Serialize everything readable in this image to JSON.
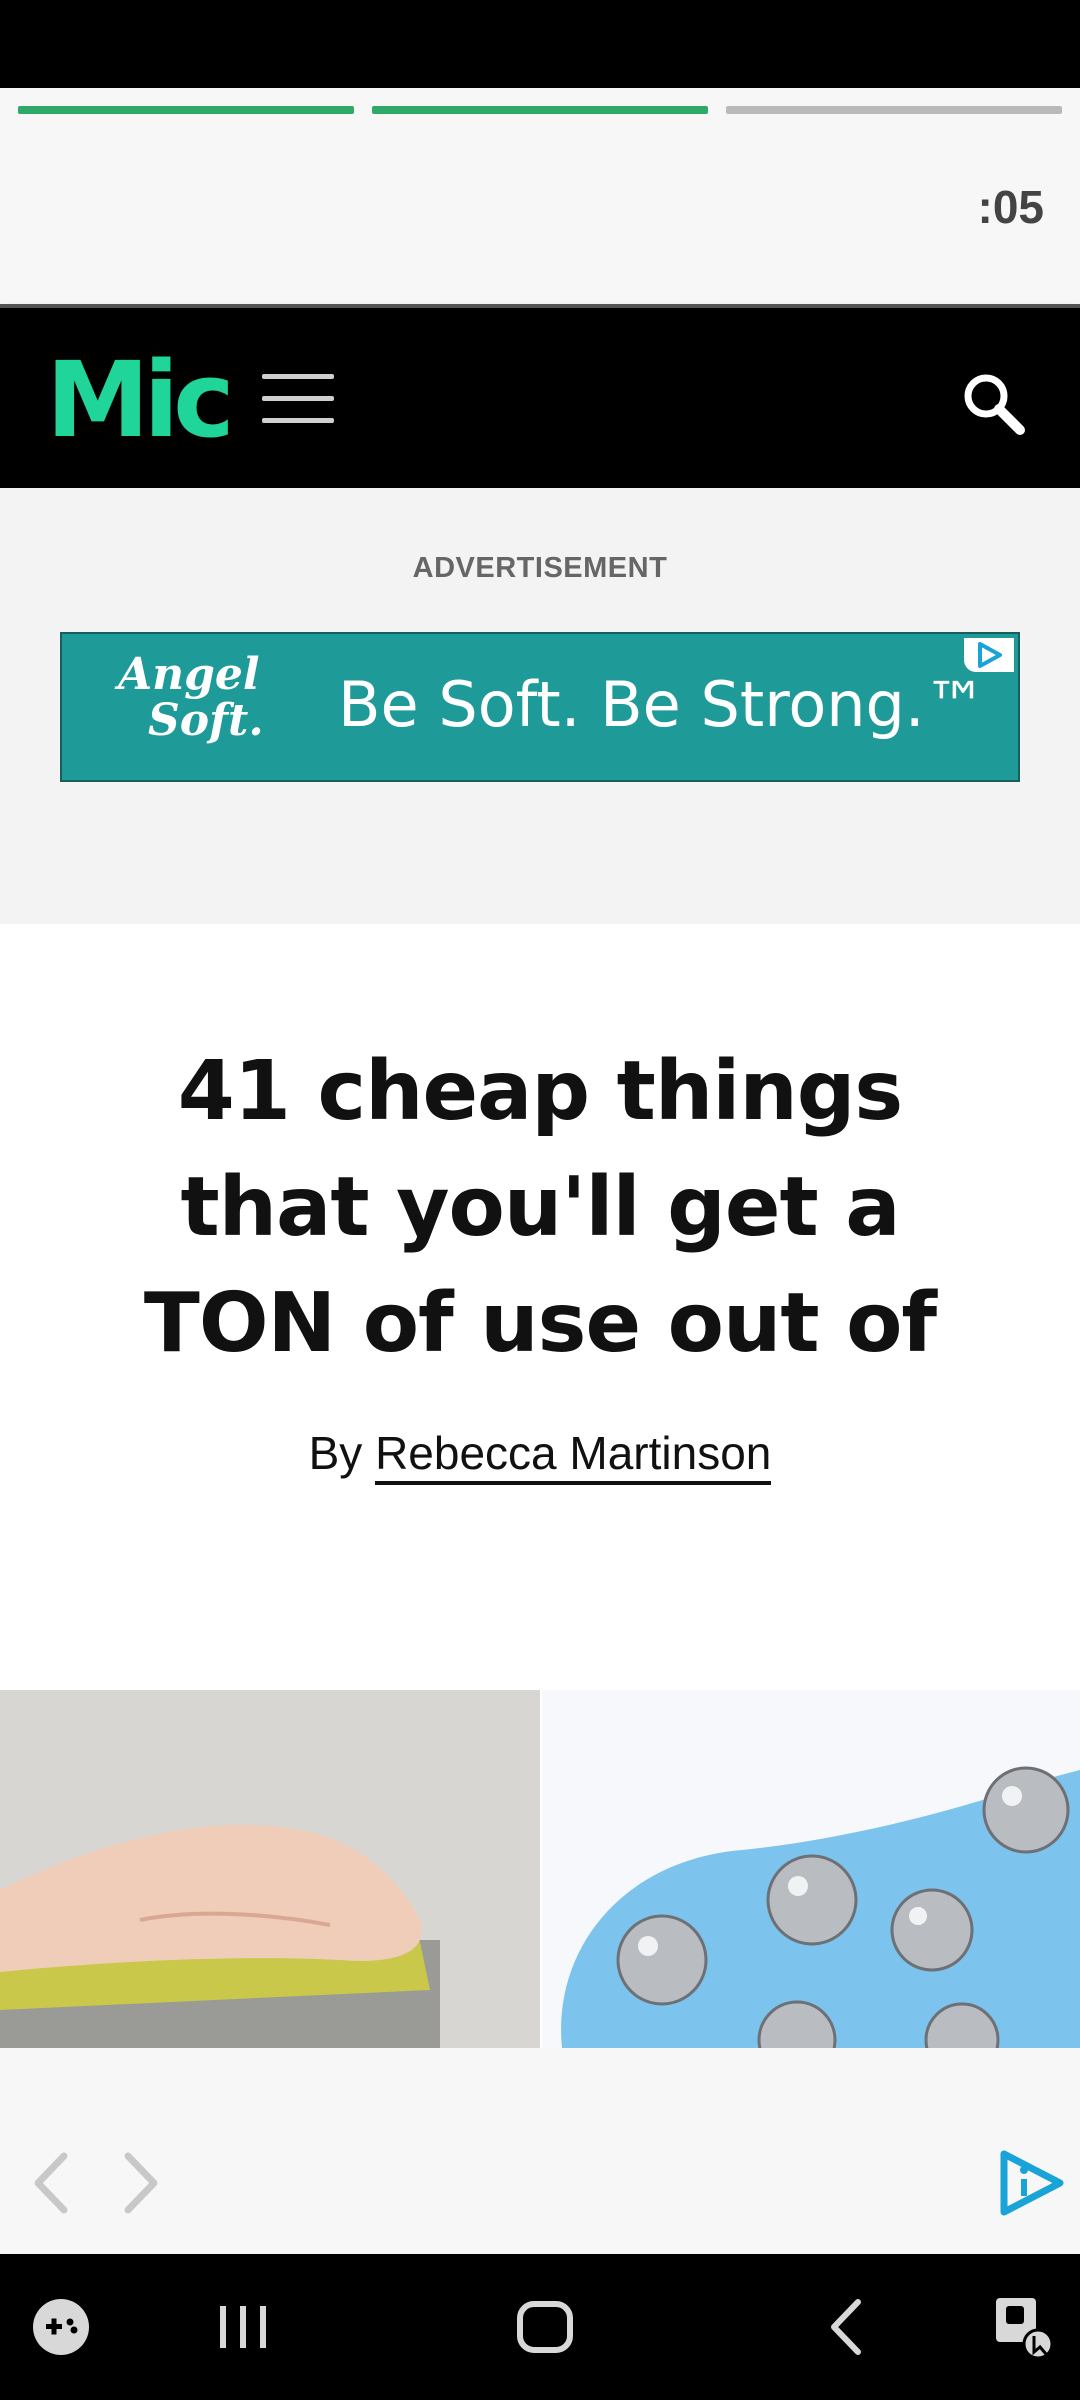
{
  "story": {
    "progress_segments": [
      {
        "state": "done"
      },
      {
        "state": "done"
      },
      {
        "state": "pending"
      }
    ],
    "timer": ":05"
  },
  "header": {
    "logo": "Mic",
    "menu_icon": "hamburger-icon",
    "search_icon": "search-icon"
  },
  "ad": {
    "label": "ADVERTISEMENT",
    "brand_line1": "Angel",
    "brand_line2": "Soft.",
    "slogan": "Be Soft. Be Strong.™",
    "badge_icon": "adchoices-icon"
  },
  "article": {
    "headline": "41 cheap things that you'll get a TON of use out of",
    "byline_prefix": "By",
    "author": "Rebecca Martinson"
  },
  "controls": {
    "prev_icon": "chevron-left-icon",
    "next_icon": "chevron-right-icon",
    "info_icon": "info-play-icon"
  },
  "system_nav": {
    "game_icon": "game-launcher-icon",
    "recents_icon": "recents-icon",
    "home_icon": "home-icon",
    "back_icon": "back-icon",
    "accessibility_icon": "accessibility-icon"
  },
  "colors": {
    "progress_done": "#2fa968",
    "progress_pending": "#b9b9b9",
    "logo": "#1fd59a",
    "ad_bg": "#1e9a98",
    "info_accent": "#1aa3d6"
  }
}
